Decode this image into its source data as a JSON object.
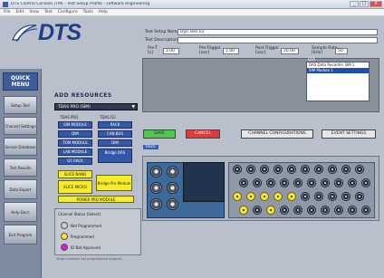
{
  "window": {
    "title": "DTS Control Console (TM) - Test Setup Profile - software engineering",
    "buttons": [
      "_",
      "□",
      "X"
    ]
  },
  "menubar": {
    "items": [
      "File",
      "Edit",
      "View",
      "Test",
      "Configure",
      "Tools",
      "Help"
    ]
  },
  "logo": {
    "text": "DTS"
  },
  "quick_menu": {
    "title": "QUICK MENU",
    "buttons": [
      "Setup Test",
      "Channel Settings",
      "Sensor Database",
      "Test Results",
      "Data Export",
      "Help Docs",
      "Exit Program"
    ]
  },
  "test_setup": {
    "name_label": "Test Setup Name",
    "name_value": "Dyn Test 01",
    "desc_label": "Test Description",
    "desc_value": "",
    "fields": [
      {
        "label": "Pre-T",
        "sub": "[s]",
        "value": "2.00"
      },
      {
        "label": "Pre-Trigger\n[sec]",
        "value": "1.00"
      },
      {
        "label": "Post-Trigger\n[sec]",
        "value": "20.00"
      },
      {
        "label": "Sample Rate\n[kHz]",
        "value": "50"
      }
    ],
    "list_header": "Q/A",
    "list_items": [
      "DAS Data Recorder SIM 1",
      "SIM Module 1",
      "",
      "",
      "",
      ""
    ],
    "list_selected": 1
  },
  "actions": {
    "save": "SAVE",
    "cancel": "CANCEL",
    "channel_mgr": "CHANNEL CONFIGURATIONS",
    "event_settings": "EVENT SETTINGS"
  },
  "add_resources": {
    "header": "ADD RESOURCES",
    "dropdown": "TDAS PRO (SIM)",
    "col_left": "TDAS PRO",
    "col_right": "TDAS G5",
    "left_buttons": [
      "SIM MODULE",
      "DIM",
      "TOM MODULE",
      "LAB MODULE",
      "G5 RACK"
    ],
    "right_buttons": [
      "RACK",
      "CAN BUS",
      "DIM",
      "Bridge DAS",
      ""
    ],
    "yellow": [
      "SLICE NANO",
      "SLICE MICRO",
      "Bridge Pro Module",
      "POWER PRO MODULE"
    ]
  },
  "hw_tab": "Rack",
  "legend": {
    "title": "Channel Status (Select)",
    "items": [
      {
        "label": "Not Programmed",
        "color": "#c8cdd6"
      },
      {
        "label": "Programmed",
        "color": "#f5e52a"
      },
      {
        "label": "ID Not Approved",
        "color": "#e414d8"
      }
    ],
    "footer": "Show channels not programmed (legend)"
  }
}
